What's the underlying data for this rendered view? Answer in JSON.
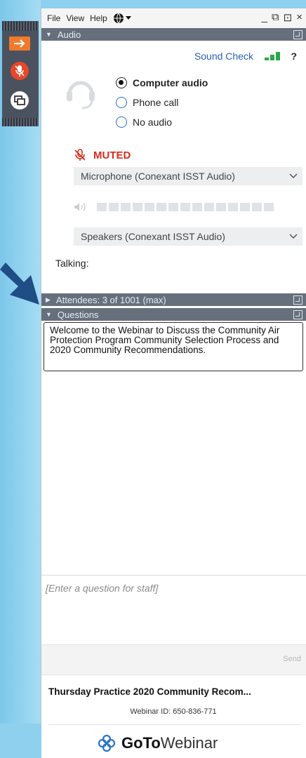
{
  "menu": {
    "file": "File",
    "view": "View",
    "help": "Help"
  },
  "window_controls": {
    "minimize": "_",
    "restore": "⧉",
    "maximize": "⊡",
    "close": "×"
  },
  "audio": {
    "header": "Audio",
    "sound_check": "Sound Check",
    "help": "?",
    "options": [
      {
        "label": "Computer audio",
        "selected": true
      },
      {
        "label": "Phone call",
        "selected": false
      },
      {
        "label": "No audio",
        "selected": false
      }
    ],
    "muted": "MUTED",
    "microphone": "Microphone (Conexant ISST Audio)",
    "speakers": "Speakers (Conexant ISST Audio)",
    "talking": "Talking:"
  },
  "attendees": {
    "header": "Attendees: 3 of 1001 (max)"
  },
  "questions": {
    "header": "Questions",
    "message": "Welcome to the Webinar to Discuss the Community Air Protection Program Community Selection Process and 2020 Community Recommendations.",
    "input_placeholder": "[Enter a question for staff]",
    "send": "Send"
  },
  "footer": {
    "title": "Thursday Practice 2020 Community Recom...",
    "webinar_id": "Webinar ID: 650-836-771",
    "brand_goto": "GoTo",
    "brand_webinar": "Webinar"
  },
  "colors": {
    "accent": "#2a5fb8",
    "muted": "#d42d1f",
    "header_bg": "#66707d",
    "meter": "#2aa84a"
  }
}
